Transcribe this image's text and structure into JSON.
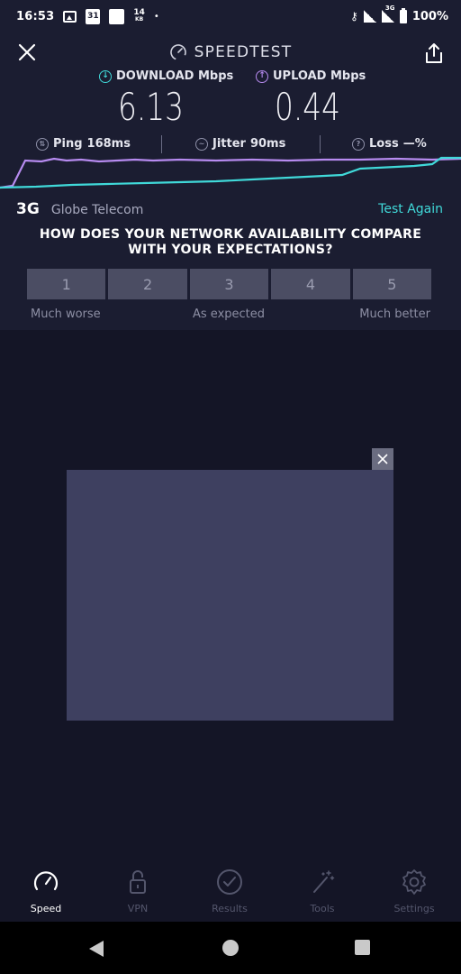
{
  "status_bar": {
    "time": "16:53",
    "calendar_day": "31",
    "data_rate_value": "14",
    "data_rate_unit": "KB",
    "battery": "100%",
    "network_type_icon": "3G",
    "icons": [
      "image-icon",
      "calendar-icon",
      "app-square-icon",
      "dot-icon",
      "vpn-key-icon",
      "signal-icon",
      "signal-3g-icon",
      "battery-icon"
    ]
  },
  "header": {
    "title": "SPEEDTEST",
    "close_icon": "close-icon",
    "share_icon": "share-icon"
  },
  "metrics": {
    "download_label": "DOWNLOAD Mbps",
    "upload_label": "UPLOAD Mbps",
    "download_value": "6.13",
    "upload_value": "0.44",
    "download_color": "#40d9d9",
    "upload_color": "#b78bf0"
  },
  "stats": {
    "ping_label": "Ping",
    "ping_value": "168ms",
    "jitter_label": "Jitter",
    "jitter_value": "90ms",
    "loss_label": "Loss",
    "loss_value": "—%"
  },
  "connection": {
    "type": "3G",
    "carrier": "Globe Telecom",
    "test_again": "Test Again"
  },
  "survey": {
    "question": "HOW DOES YOUR NETWORK AVAILABILITY COMPARE WITH YOUR EXPECTATIONS?",
    "options": [
      "1",
      "2",
      "3",
      "4",
      "5"
    ],
    "label_low": "Much worse",
    "label_mid": "As expected",
    "label_high": "Much better"
  },
  "ad": {
    "close_icon": "close-icon"
  },
  "bottom_nav": {
    "items": [
      {
        "label": "Speed",
        "icon": "speedometer-icon",
        "active": true
      },
      {
        "label": "VPN",
        "icon": "lock-icon",
        "active": false
      },
      {
        "label": "Results",
        "icon": "checkmark-circle-icon",
        "active": false
      },
      {
        "label": "Tools",
        "icon": "magic-wand-icon",
        "active": false
      },
      {
        "label": "Settings",
        "icon": "gear-icon",
        "active": false
      }
    ]
  },
  "colors": {
    "accent": "#40d9d9",
    "background": "#141526",
    "panel": "#1b1d31"
  }
}
